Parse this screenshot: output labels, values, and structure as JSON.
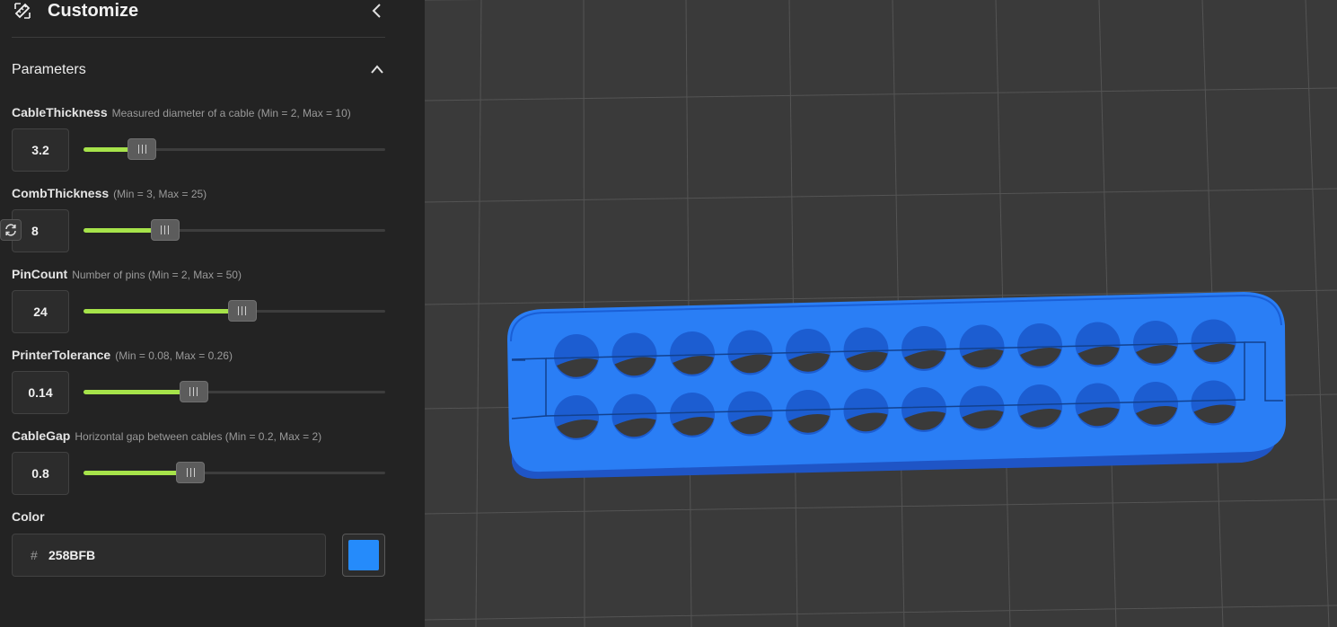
{
  "header": {
    "title": "Customize"
  },
  "section": {
    "label": "Parameters"
  },
  "params": [
    {
      "name": "CableThickness",
      "desc": "Measured diameter of a cable (Min = 2, Max = 10)",
      "value": "3.2",
      "min": 2,
      "max": 10,
      "track_max": 50
    },
    {
      "name": "CombThickness",
      "desc": "(Min = 3, Max = 25)",
      "value": "8",
      "min": 3,
      "max": 25,
      "track_max": 50
    },
    {
      "name": "PinCount",
      "desc": "Number of pins (Min = 2, Max = 50)",
      "value": "24",
      "min": 2,
      "max": 50,
      "track_max": 50
    },
    {
      "name": "PrinterTolerance",
      "desc": "(Min = 0.08, Max = 0.26)",
      "value": "0.14",
      "min": 0.08,
      "max": 0.26,
      "track_max": 0.5
    },
    {
      "name": "CableGap",
      "desc": "Horizontal gap between cables (Min = 0.2, Max = 2)",
      "value": "0.8",
      "min": 0.2,
      "max": 2,
      "track_max": 3
    }
  ],
  "color": {
    "label": "Color",
    "hash": "#",
    "hex": "258BFB",
    "swatch": "#258BFB"
  },
  "model": {
    "pin_rows": 2,
    "pins_per_row": 12
  },
  "theme": {
    "accent": "#a6e34a",
    "model_color": "#258BFB",
    "panel_bg": "#232323",
    "viewport_bg": "#3a3a3a"
  }
}
